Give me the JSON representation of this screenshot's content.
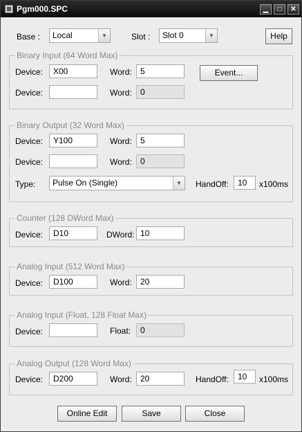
{
  "window": {
    "title": "Pgm000.SPC",
    "minimize_icon": "minimize-icon",
    "maximize_icon": "maximize-icon",
    "close_icon": "close-icon"
  },
  "top": {
    "base_label": "Base :",
    "base_value": "Local",
    "slot_label": "Slot :",
    "slot_value": "Slot 0",
    "help_label": "Help"
  },
  "binary_input": {
    "title": "Binary Input (64 Word Max)",
    "row1": {
      "device_label": "Device:",
      "device_value": "X00",
      "word_label": "Word:",
      "word_value": "5"
    },
    "row2": {
      "device_label": "Device:",
      "device_value": "",
      "word_label": "Word:",
      "word_value": "0"
    },
    "event_label": "Event..."
  },
  "binary_output": {
    "title": "Binary Output (32 Word Max)",
    "row1": {
      "device_label": "Device:",
      "device_value": "Y100",
      "word_label": "Word:",
      "word_value": "5"
    },
    "row2": {
      "device_label": "Device:",
      "device_value": "",
      "word_label": "Word:",
      "word_value": "0"
    },
    "type_label": "Type:",
    "type_value": "Pulse On (Single)",
    "handoff_label": "HandOff:",
    "handoff_value": "10",
    "handoff_unit": "x100ms"
  },
  "counter": {
    "title": "Counter (128 DWord Max)",
    "device_label": "Device:",
    "device_value": "D10",
    "dword_label": "DWord:",
    "dword_value": "10"
  },
  "analog_input": {
    "title": "Analog Input (512 Word Max)",
    "device_label": "Device:",
    "device_value": "D100",
    "word_label": "Word:",
    "word_value": "20"
  },
  "analog_input_float": {
    "title": "Analog Input (Float, 128 Float Max)",
    "device_label": "Device:",
    "device_value": "",
    "float_label": "Float:",
    "float_value": "0"
  },
  "analog_output": {
    "title": "Analog Output (128 Word Max)",
    "device_label": "Device:",
    "device_value": "D200",
    "word_label": "Word:",
    "word_value": "20",
    "handoff_label": "HandOff:",
    "handoff_value": "10",
    "handoff_unit": "x100ms"
  },
  "footer": {
    "online_edit_label": "Online Edit",
    "save_label": "Save",
    "close_label": "Close"
  }
}
